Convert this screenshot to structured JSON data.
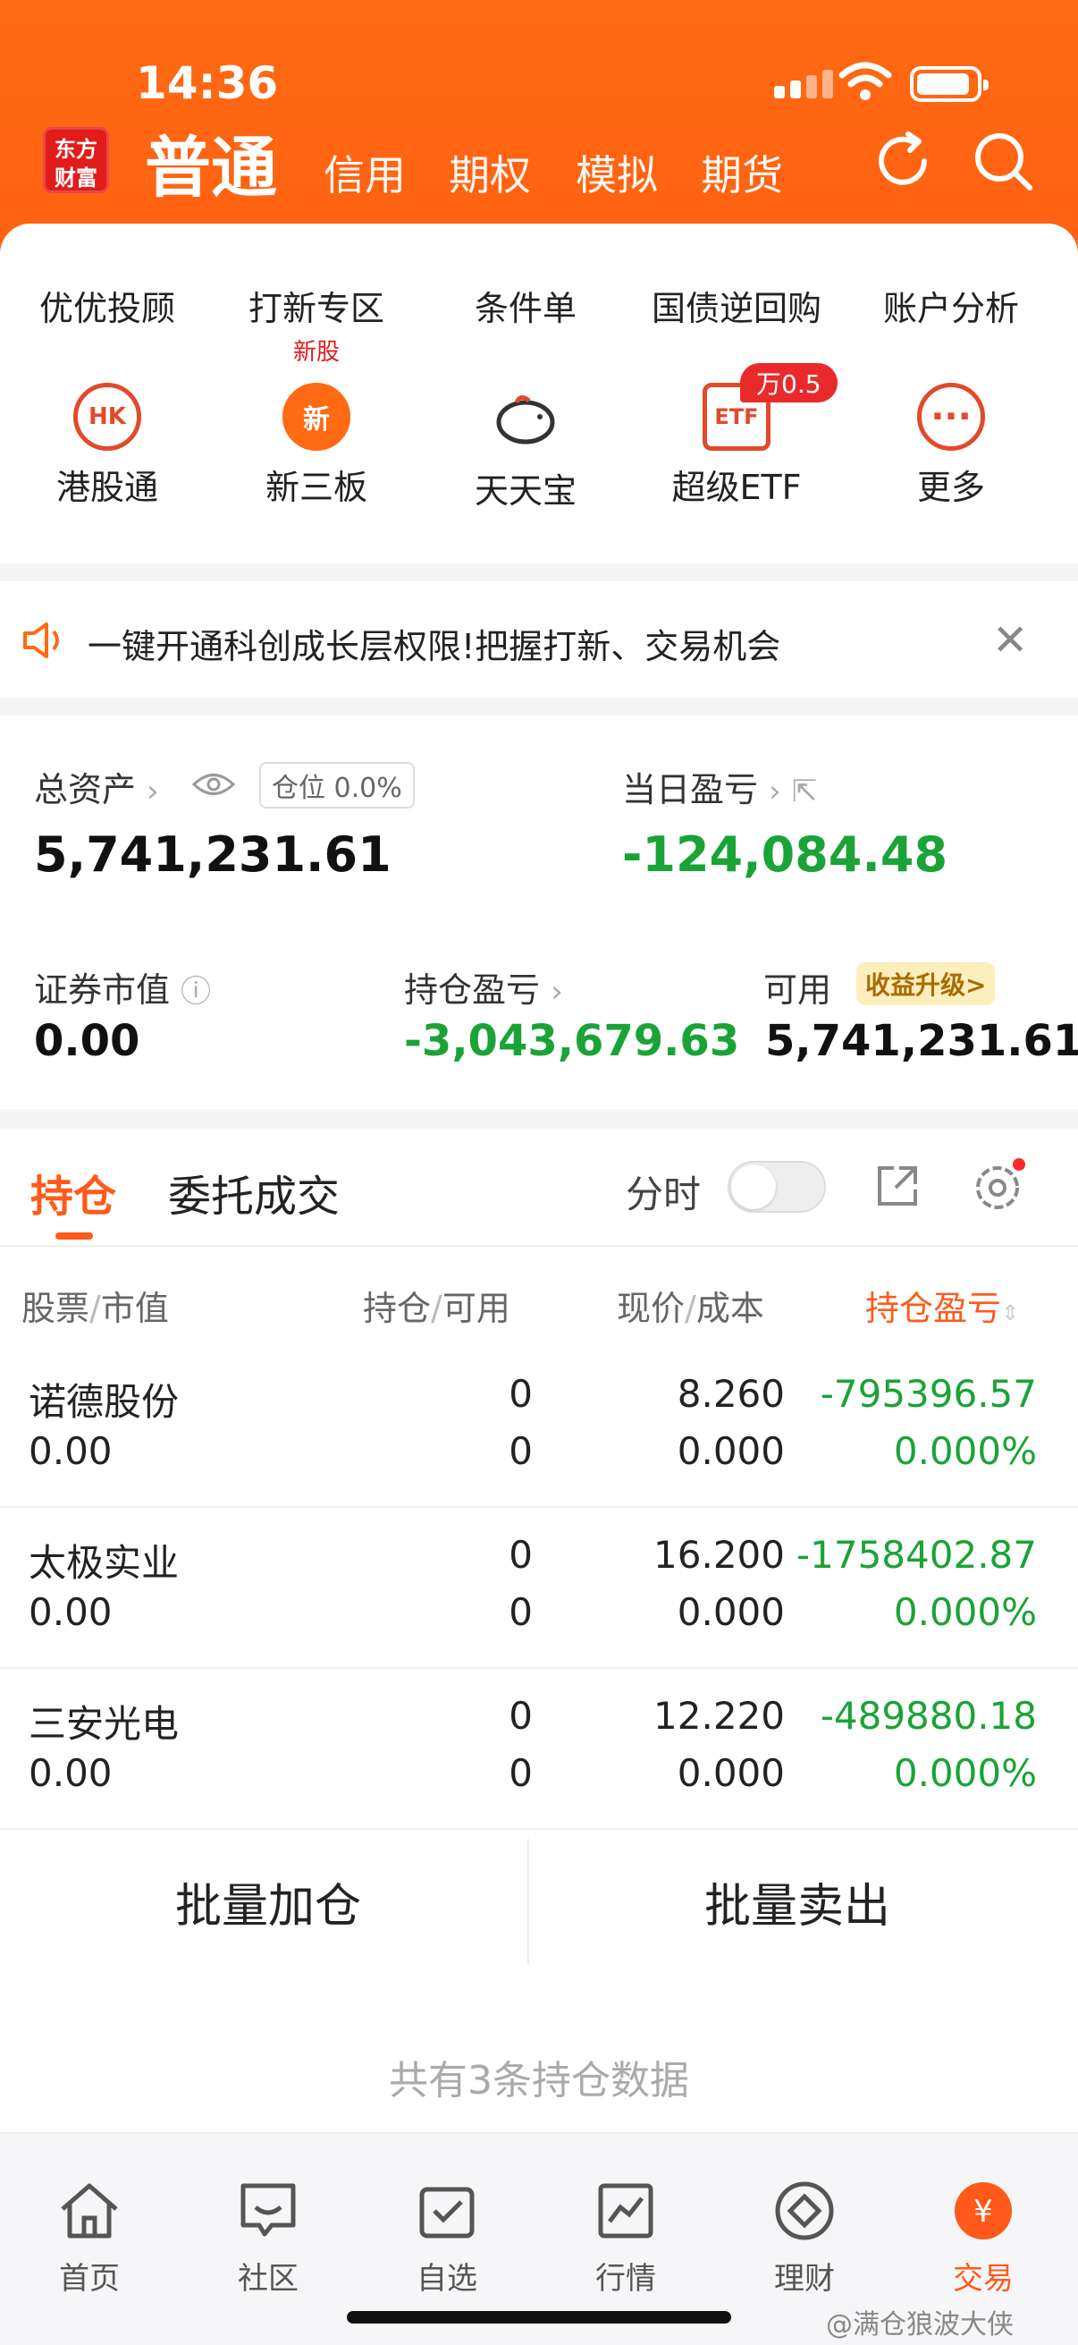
{
  "status_bar": {
    "time": "14:36"
  },
  "header": {
    "logo_line1": "东方",
    "logo_line2": "财富",
    "account_type": "普通",
    "tabs": [
      "信用",
      "期权",
      "模拟",
      "期货"
    ]
  },
  "grid_row1": [
    {
      "label": "优优投顾",
      "sub": ""
    },
    {
      "label": "打新专区",
      "sub": "新股"
    },
    {
      "label": "条件单",
      "sub": ""
    },
    {
      "label": "国债逆回购",
      "sub": ""
    },
    {
      "label": "账户分析",
      "sub": ""
    }
  ],
  "grid_row2": [
    {
      "label": "港股通",
      "icon_text": "HK"
    },
    {
      "label": "新三板",
      "icon_text": "新"
    },
    {
      "label": "天天宝",
      "icon_text": ""
    },
    {
      "label": "超级ETF",
      "icon_text": "ETF"
    },
    {
      "label": "更多",
      "icon_text": "···"
    }
  ],
  "etf_badge": "万0.5",
  "notice": {
    "text": "一键开通科创成长层权限!把握打新、交易机会"
  },
  "assets": {
    "total_label": "总资产",
    "position_pill": "仓位  0.0%",
    "total_value": "5,741,231.61",
    "daily_pl_label": "当日盈亏",
    "daily_pl_value": "-124,084.48",
    "market_value_label": "证券市值",
    "market_value": "0.00",
    "holding_pl_label": "持仓盈亏",
    "holding_pl_value": "-3,043,679.63",
    "available_label": "可用",
    "upgrade_badge": "收益升级>",
    "available_value": "5,741,231.61"
  },
  "positions": {
    "tab_active": "持仓",
    "tab_orders": "委托成交",
    "toggle_label": "分时",
    "headers": {
      "c1a": "股票",
      "c1b": "市值",
      "c2a": "持仓",
      "c2b": "可用",
      "c3a": "现价",
      "c3b": "成本",
      "c4": "持仓盈亏"
    },
    "rows": [
      {
        "name": "诺德股份",
        "mv": "0.00",
        "hold": "0",
        "avail": "0",
        "price": "8.260",
        "cost": "0.000",
        "pl": "-795396.57",
        "pct": "0.000%"
      },
      {
        "name": "太极实业",
        "mv": "0.00",
        "hold": "0",
        "avail": "0",
        "price": "16.200",
        "cost": "0.000",
        "pl": "-1758402.87",
        "pct": "0.000%"
      },
      {
        "name": "三安光电",
        "mv": "0.00",
        "hold": "0",
        "avail": "0",
        "price": "12.220",
        "cost": "0.000",
        "pl": "-489880.18",
        "pct": "0.000%"
      }
    ],
    "batch_add": "批量加仓",
    "batch_sell": "批量卖出",
    "count_text": "共有3条持仓数据"
  },
  "tabbar": [
    {
      "label": "首页"
    },
    {
      "label": "社区"
    },
    {
      "label": "自选"
    },
    {
      "label": "行情"
    },
    {
      "label": "理财"
    },
    {
      "label": "交易"
    }
  ],
  "watermark": "@满仓狼波大侠",
  "colors": {
    "brand": "#ff6012",
    "gain_negative": "#1aa336",
    "accent_red": "#e11a1a"
  }
}
